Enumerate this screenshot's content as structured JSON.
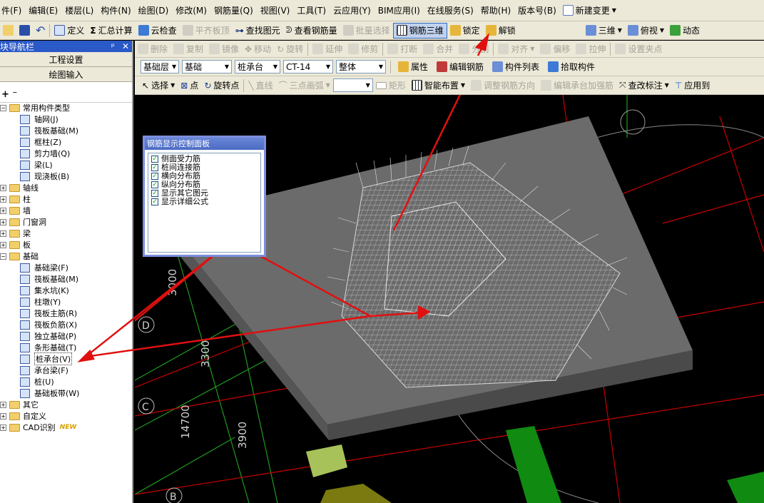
{
  "menubar": {
    "items": [
      "件(F)",
      "编辑(E)",
      "楼层(L)",
      "构件(N)",
      "绘图(D)",
      "修改(M)",
      "钢筋量(Q)",
      "视图(V)",
      "工具(T)",
      "云应用(Y)",
      "BIM应用(I)",
      "在线服务(S)",
      "帮助(H)",
      "版本号(B)"
    ],
    "new_change": "新建变更"
  },
  "toolbar1": {
    "define": "定义",
    "sum": "汇总计算",
    "cloud_check": "云检查",
    "align_slab": "平齐板顶",
    "find_elem": "查找图元",
    "view_rebar": "查看钢筋量",
    "batch_select": "批量选择",
    "rebar_3d": "钢筋三维",
    "lock": "锁定",
    "unlock": "解锁",
    "view_3d": "三维",
    "top_view": "俯视",
    "dynamic": "动态"
  },
  "toolbar2": {
    "delete": "删除",
    "copy": "复制",
    "mirror": "镜像",
    "move": "移动",
    "rotate": "旋转",
    "extend": "延伸",
    "trim": "修剪",
    "break": "打断",
    "merge": "合并",
    "split": "分割",
    "align": "对齐",
    "offset": "偏移",
    "stretch": "拉伸",
    "set_point": "设置夹点"
  },
  "toolbar3": {
    "floor": "基础层",
    "category": "基础",
    "type": "桩承台",
    "element": "CT-14",
    "scope": "整体",
    "props": "属性",
    "edit_rebar": "编辑钢筋",
    "comp_list": "构件列表",
    "pick": "拾取构件"
  },
  "toolbar4": {
    "select": "选择",
    "point": "点",
    "rotate_point": "旋转点",
    "line": "直线",
    "arc": "三点画弧",
    "rect": "矩形",
    "smart": "智能布置",
    "adjust_dir": "调整钢筋方向",
    "edit_cap": "编辑承台加强筋",
    "change_label": "查改标注",
    "apply_same": "应用到"
  },
  "nav": {
    "title": "块导航栏",
    "project_settings": "工程设置",
    "drawing_input": "绘图输入",
    "tree": [
      {
        "label": "常用构件类型",
        "kind": "folder",
        "level": 0,
        "open": true
      },
      {
        "label": "轴网(J)",
        "kind": "comp",
        "level": 1
      },
      {
        "label": "筏板基础(M)",
        "kind": "comp",
        "level": 1
      },
      {
        "label": "框柱(Z)",
        "kind": "comp",
        "level": 1
      },
      {
        "label": "剪力墙(Q)",
        "kind": "comp",
        "level": 1
      },
      {
        "label": "梁(L)",
        "kind": "comp",
        "level": 1
      },
      {
        "label": "现浇板(B)",
        "kind": "comp",
        "level": 1
      },
      {
        "label": "轴线",
        "kind": "folder",
        "level": 0
      },
      {
        "label": "柱",
        "kind": "folder",
        "level": 0
      },
      {
        "label": "墙",
        "kind": "folder",
        "level": 0
      },
      {
        "label": "门窗洞",
        "kind": "folder",
        "level": 0
      },
      {
        "label": "梁",
        "kind": "folder",
        "level": 0
      },
      {
        "label": "板",
        "kind": "folder",
        "level": 0
      },
      {
        "label": "基础",
        "kind": "folder",
        "level": 0,
        "open": true
      },
      {
        "label": "基础梁(F)",
        "kind": "comp",
        "level": 1
      },
      {
        "label": "筏板基础(M)",
        "kind": "comp",
        "level": 1
      },
      {
        "label": "集水坑(K)",
        "kind": "comp",
        "level": 1
      },
      {
        "label": "柱墩(Y)",
        "kind": "comp",
        "level": 1
      },
      {
        "label": "筏板主筋(R)",
        "kind": "comp",
        "level": 1
      },
      {
        "label": "筏板负筋(X)",
        "kind": "comp",
        "level": 1
      },
      {
        "label": "独立基础(P)",
        "kind": "comp",
        "level": 1
      },
      {
        "label": "条形基础(T)",
        "kind": "comp",
        "level": 1
      },
      {
        "label": "桩承台(V)",
        "kind": "comp",
        "level": 1,
        "selected": true
      },
      {
        "label": "承台梁(F)",
        "kind": "comp",
        "level": 1
      },
      {
        "label": "桩(U)",
        "kind": "comp",
        "level": 1
      },
      {
        "label": "基础板带(W)",
        "kind": "comp",
        "level": 1
      },
      {
        "label": "其它",
        "kind": "folder",
        "level": 0
      },
      {
        "label": "自定义",
        "kind": "folder",
        "level": 0
      },
      {
        "label": "CAD识别",
        "kind": "folder",
        "level": 0,
        "badge": "NEW"
      }
    ]
  },
  "panel": {
    "title": "钢筋显示控制面板",
    "options": [
      "侧面受力筋",
      "桩间连接筋",
      "横向分布筋",
      "纵向分布筋",
      "显示其它图元",
      "显示详细公式"
    ]
  },
  "canvas": {
    "axis_labels": [
      "D",
      "C",
      "B"
    ],
    "dim_labels": [
      "3000",
      "3300",
      "14700",
      "3900"
    ]
  },
  "colors": {
    "toolbar_bg": "#ece9d8",
    "nav_title": "#2a59c8",
    "annotation_arrow": "#e01010",
    "grid_red": "#c00000",
    "grid_green": "#00b000",
    "slab": "#6a6a6a"
  }
}
